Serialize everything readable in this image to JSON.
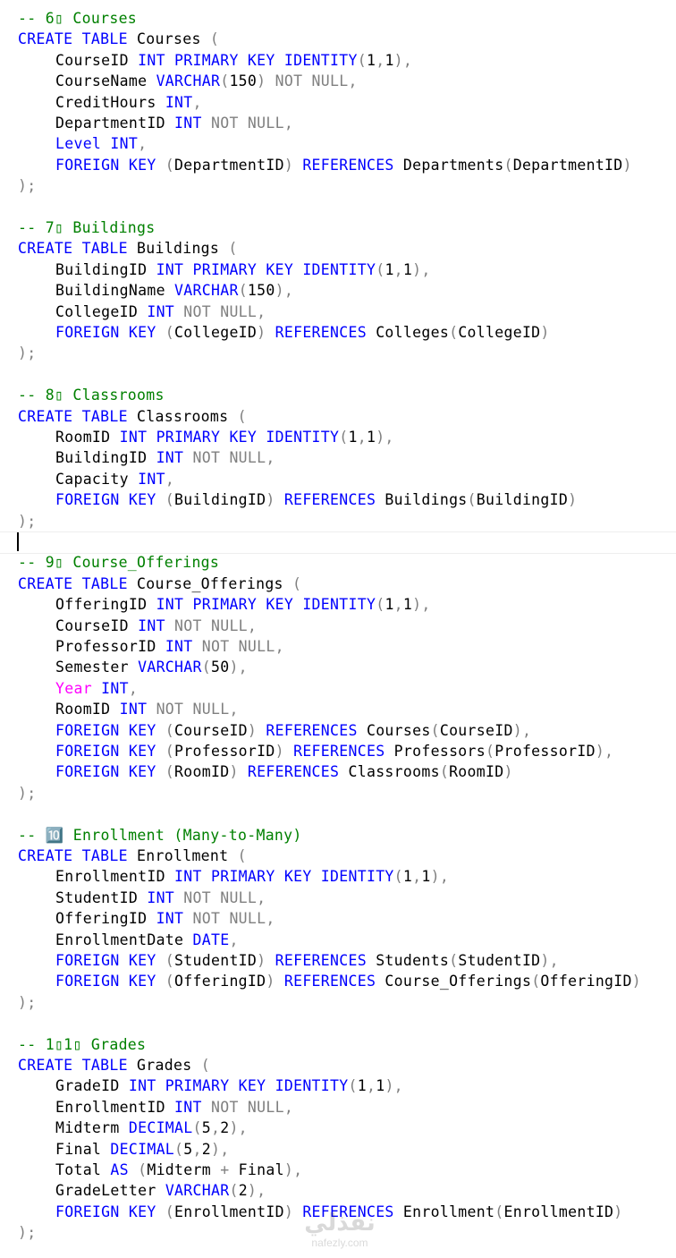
{
  "colors": {
    "keyword": "#0000ff",
    "comment": "#008000",
    "operator": "#808080",
    "function": "#ff00ff",
    "identifier": "#000000",
    "background": "#ffffff"
  },
  "lines": [
    [
      [
        "cm",
        "-- 6▯ Courses"
      ]
    ],
    [
      [
        "kw",
        "CREATE TABLE"
      ],
      [
        "tx",
        " Courses "
      ],
      [
        "gy",
        "("
      ]
    ],
    [
      [
        "tx",
        "CourseID "
      ],
      [
        "kw",
        "INT PRIMARY KEY IDENTITY"
      ],
      [
        "gy",
        "("
      ],
      [
        "tx",
        "1"
      ],
      [
        "gy",
        ","
      ],
      [
        "tx",
        "1"
      ],
      [
        "gy",
        "),"
      ]
    ],
    [
      [
        "tx",
        "CourseName "
      ],
      [
        "kw",
        "VARCHAR"
      ],
      [
        "gy",
        "("
      ],
      [
        "tx",
        "150"
      ],
      [
        "gy",
        ") NOT NULL,"
      ]
    ],
    [
      [
        "tx",
        "CreditHours "
      ],
      [
        "kw",
        "INT"
      ],
      [
        "gy",
        ","
      ]
    ],
    [
      [
        "tx",
        "DepartmentID "
      ],
      [
        "kw",
        "INT"
      ],
      [
        "gy",
        " NOT NULL,"
      ]
    ],
    [
      [
        "kw",
        "Level INT"
      ],
      [
        "gy",
        ","
      ]
    ],
    [
      [
        "kw",
        "FOREIGN KEY"
      ],
      [
        "gy",
        " ("
      ],
      [
        "tx",
        "DepartmentID"
      ],
      [
        "gy",
        ")"
      ],
      [
        "kw",
        " REFERENCES"
      ],
      [
        "tx",
        " Departments"
      ],
      [
        "gy",
        "("
      ],
      [
        "tx",
        "DepartmentID"
      ],
      [
        "gy",
        ")"
      ]
    ],
    [
      [
        "gy",
        ");"
      ]
    ],
    [],
    [
      [
        "cm",
        "-- 7▯ Buildings"
      ]
    ],
    [
      [
        "kw",
        "CREATE TABLE"
      ],
      [
        "tx",
        " Buildings "
      ],
      [
        "gy",
        "("
      ]
    ],
    [
      [
        "tx",
        "BuildingID "
      ],
      [
        "kw",
        "INT PRIMARY KEY IDENTITY"
      ],
      [
        "gy",
        "("
      ],
      [
        "tx",
        "1"
      ],
      [
        "gy",
        ","
      ],
      [
        "tx",
        "1"
      ],
      [
        "gy",
        "),"
      ]
    ],
    [
      [
        "tx",
        "BuildingName "
      ],
      [
        "kw",
        "VARCHAR"
      ],
      [
        "gy",
        "("
      ],
      [
        "tx",
        "150"
      ],
      [
        "gy",
        "),"
      ]
    ],
    [
      [
        "tx",
        "CollegeID "
      ],
      [
        "kw",
        "INT"
      ],
      [
        "gy",
        " NOT NULL,"
      ]
    ],
    [
      [
        "kw",
        "FOREIGN KEY"
      ],
      [
        "gy",
        " ("
      ],
      [
        "tx",
        "CollegeID"
      ],
      [
        "gy",
        ")"
      ],
      [
        "kw",
        " REFERENCES"
      ],
      [
        "tx",
        " Colleges"
      ],
      [
        "gy",
        "("
      ],
      [
        "tx",
        "CollegeID"
      ],
      [
        "gy",
        ")"
      ]
    ],
    [
      [
        "gy",
        ");"
      ]
    ],
    [],
    [
      [
        "cm",
        "-- 8▯ Classrooms"
      ]
    ],
    [
      [
        "kw",
        "CREATE TABLE"
      ],
      [
        "tx",
        " Classrooms "
      ],
      [
        "gy",
        "("
      ]
    ],
    [
      [
        "tx",
        "RoomID "
      ],
      [
        "kw",
        "INT PRIMARY KEY IDENTITY"
      ],
      [
        "gy",
        "("
      ],
      [
        "tx",
        "1"
      ],
      [
        "gy",
        ","
      ],
      [
        "tx",
        "1"
      ],
      [
        "gy",
        "),"
      ]
    ],
    [
      [
        "tx",
        "BuildingID "
      ],
      [
        "kw",
        "INT"
      ],
      [
        "gy",
        " NOT NULL,"
      ]
    ],
    [
      [
        "tx",
        "Capacity "
      ],
      [
        "kw",
        "INT"
      ],
      [
        "gy",
        ","
      ]
    ],
    [
      [
        "kw",
        "FOREIGN KEY"
      ],
      [
        "gy",
        " ("
      ],
      [
        "tx",
        "BuildingID"
      ],
      [
        "gy",
        ")"
      ],
      [
        "kw",
        " REFERENCES"
      ],
      [
        "tx",
        " Buildings"
      ],
      [
        "gy",
        "("
      ],
      [
        "tx",
        "BuildingID"
      ],
      [
        "gy",
        ")"
      ]
    ],
    [
      [
        "gy",
        ");"
      ]
    ],
    [],
    [
      [
        "cm",
        "-- 9▯ Course_Offerings"
      ]
    ],
    [
      [
        "kw",
        "CREATE TABLE"
      ],
      [
        "tx",
        " Course_Offerings "
      ],
      [
        "gy",
        "("
      ]
    ],
    [
      [
        "tx",
        "OfferingID "
      ],
      [
        "kw",
        "INT PRIMARY KEY IDENTITY"
      ],
      [
        "gy",
        "("
      ],
      [
        "tx",
        "1"
      ],
      [
        "gy",
        ","
      ],
      [
        "tx",
        "1"
      ],
      [
        "gy",
        "),"
      ]
    ],
    [
      [
        "tx",
        "CourseID "
      ],
      [
        "kw",
        "INT"
      ],
      [
        "gy",
        " NOT NULL,"
      ]
    ],
    [
      [
        "tx",
        "ProfessorID "
      ],
      [
        "kw",
        "INT"
      ],
      [
        "gy",
        " NOT NULL,"
      ]
    ],
    [
      [
        "tx",
        "Semester "
      ],
      [
        "kw",
        "VARCHAR"
      ],
      [
        "gy",
        "("
      ],
      [
        "tx",
        "50"
      ],
      [
        "gy",
        "),"
      ]
    ],
    [
      [
        "mg",
        "Year"
      ],
      [
        "kw",
        " INT"
      ],
      [
        "gy",
        ","
      ]
    ],
    [
      [
        "tx",
        "RoomID "
      ],
      [
        "kw",
        "INT"
      ],
      [
        "gy",
        " NOT NULL,"
      ]
    ],
    [
      [
        "kw",
        "FOREIGN KEY"
      ],
      [
        "gy",
        " ("
      ],
      [
        "tx",
        "CourseID"
      ],
      [
        "gy",
        ")"
      ],
      [
        "kw",
        " REFERENCES"
      ],
      [
        "tx",
        " Courses"
      ],
      [
        "gy",
        "("
      ],
      [
        "tx",
        "CourseID"
      ],
      [
        "gy",
        "),"
      ]
    ],
    [
      [
        "kw",
        "FOREIGN KEY"
      ],
      [
        "gy",
        " ("
      ],
      [
        "tx",
        "ProfessorID"
      ],
      [
        "gy",
        ")"
      ],
      [
        "kw",
        " REFERENCES"
      ],
      [
        "tx",
        " Professors"
      ],
      [
        "gy",
        "("
      ],
      [
        "tx",
        "ProfessorID"
      ],
      [
        "gy",
        "),"
      ]
    ],
    [
      [
        "kw",
        "FOREIGN KEY"
      ],
      [
        "gy",
        " ("
      ],
      [
        "tx",
        "RoomID"
      ],
      [
        "gy",
        ")"
      ],
      [
        "kw",
        " REFERENCES"
      ],
      [
        "tx",
        " Classrooms"
      ],
      [
        "gy",
        "("
      ],
      [
        "tx",
        "RoomID"
      ],
      [
        "gy",
        ")"
      ]
    ],
    [
      [
        "gy",
        ");"
      ]
    ],
    [],
    [
      [
        "cm",
        "-- 🔟 Enrollment (Many-to-Many)"
      ]
    ],
    [
      [
        "kw",
        "CREATE TABLE"
      ],
      [
        "tx",
        " Enrollment "
      ],
      [
        "gy",
        "("
      ]
    ],
    [
      [
        "tx",
        "EnrollmentID "
      ],
      [
        "kw",
        "INT PRIMARY KEY IDENTITY"
      ],
      [
        "gy",
        "("
      ],
      [
        "tx",
        "1"
      ],
      [
        "gy",
        ","
      ],
      [
        "tx",
        "1"
      ],
      [
        "gy",
        "),"
      ]
    ],
    [
      [
        "tx",
        "StudentID "
      ],
      [
        "kw",
        "INT"
      ],
      [
        "gy",
        " NOT NULL,"
      ]
    ],
    [
      [
        "tx",
        "OfferingID "
      ],
      [
        "kw",
        "INT"
      ],
      [
        "gy",
        " NOT NULL,"
      ]
    ],
    [
      [
        "tx",
        "EnrollmentDate "
      ],
      [
        "kw",
        "DATE"
      ],
      [
        "gy",
        ","
      ]
    ],
    [
      [
        "kw",
        "FOREIGN KEY"
      ],
      [
        "gy",
        " ("
      ],
      [
        "tx",
        "StudentID"
      ],
      [
        "gy",
        ")"
      ],
      [
        "kw",
        " REFERENCES"
      ],
      [
        "tx",
        " Students"
      ],
      [
        "gy",
        "("
      ],
      [
        "tx",
        "StudentID"
      ],
      [
        "gy",
        "),"
      ]
    ],
    [
      [
        "kw",
        "FOREIGN KEY"
      ],
      [
        "gy",
        " ("
      ],
      [
        "tx",
        "OfferingID"
      ],
      [
        "gy",
        ")"
      ],
      [
        "kw",
        " REFERENCES"
      ],
      [
        "tx",
        " Course_Offerings"
      ],
      [
        "gy",
        "("
      ],
      [
        "tx",
        "OfferingID"
      ],
      [
        "gy",
        ")"
      ]
    ],
    [
      [
        "gy",
        ");"
      ]
    ],
    [],
    [
      [
        "cm",
        "-- 1▯1▯ Grades"
      ]
    ],
    [
      [
        "kw",
        "CREATE TABLE"
      ],
      [
        "tx",
        " Grades "
      ],
      [
        "gy",
        "("
      ]
    ],
    [
      [
        "tx",
        "GradeID "
      ],
      [
        "kw",
        "INT PRIMARY KEY IDENTITY"
      ],
      [
        "gy",
        "("
      ],
      [
        "tx",
        "1"
      ],
      [
        "gy",
        ","
      ],
      [
        "tx",
        "1"
      ],
      [
        "gy",
        "),"
      ]
    ],
    [
      [
        "tx",
        "EnrollmentID "
      ],
      [
        "kw",
        "INT"
      ],
      [
        "gy",
        " NOT NULL,"
      ]
    ],
    [
      [
        "tx",
        "Midterm "
      ],
      [
        "kw",
        "DECIMAL"
      ],
      [
        "gy",
        "("
      ],
      [
        "tx",
        "5"
      ],
      [
        "gy",
        ","
      ],
      [
        "tx",
        "2"
      ],
      [
        "gy",
        "),"
      ]
    ],
    [
      [
        "tx",
        "Final "
      ],
      [
        "kw",
        "DECIMAL"
      ],
      [
        "gy",
        "("
      ],
      [
        "tx",
        "5"
      ],
      [
        "gy",
        ","
      ],
      [
        "tx",
        "2"
      ],
      [
        "gy",
        "),"
      ]
    ],
    [
      [
        "tx",
        "Total "
      ],
      [
        "kw",
        "AS"
      ],
      [
        "gy",
        " ("
      ],
      [
        "tx",
        "Midterm "
      ],
      [
        "gy",
        "+"
      ],
      [
        "tx",
        " Final"
      ],
      [
        "gy",
        "),"
      ]
    ],
    [
      [
        "tx",
        "GradeLetter "
      ],
      [
        "kw",
        "VARCHAR"
      ],
      [
        "gy",
        "("
      ],
      [
        "tx",
        "2"
      ],
      [
        "gy",
        "),"
      ]
    ],
    [
      [
        "kw",
        "FOREIGN KEY"
      ],
      [
        "gy",
        " ("
      ],
      [
        "tx",
        "EnrollmentID"
      ],
      [
        "gy",
        ")"
      ],
      [
        "kw",
        " REFERENCES"
      ],
      [
        "tx",
        " Enrollment"
      ],
      [
        "gy",
        "("
      ],
      [
        "tx",
        "EnrollmentID"
      ],
      [
        "gy",
        ")"
      ]
    ],
    [
      [
        "gy",
        ");"
      ]
    ]
  ],
  "watermark": {
    "text": "نفذلي",
    "url": "nafezly.com"
  }
}
